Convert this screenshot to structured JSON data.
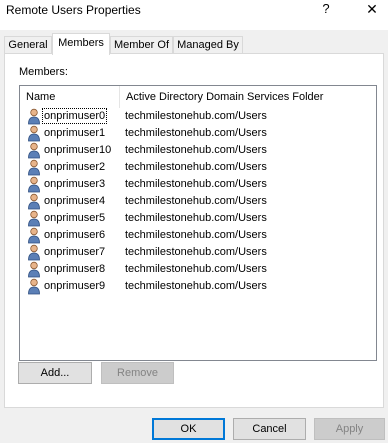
{
  "window": {
    "title": "Remote Users Properties",
    "help_glyph": "?",
    "close_glyph": "✕"
  },
  "tabs": [
    {
      "label": "General"
    },
    {
      "label": "Members"
    },
    {
      "label": "Member Of"
    },
    {
      "label": "Managed By"
    }
  ],
  "active_tab": "Members",
  "members_label": "Members:",
  "columns": {
    "name": "Name",
    "folder": "Active Directory Domain Services Folder"
  },
  "rows": [
    {
      "name": "onprimuser0",
      "folder": "techmilestonehub.com/Users"
    },
    {
      "name": "onprimuser1",
      "folder": "techmilestonehub.com/Users"
    },
    {
      "name": "onprimuser10",
      "folder": "techmilestonehub.com/Users"
    },
    {
      "name": "onprimuser2",
      "folder": "techmilestonehub.com/Users"
    },
    {
      "name": "onprimuser3",
      "folder": "techmilestonehub.com/Users"
    },
    {
      "name": "onprimuser4",
      "folder": "techmilestonehub.com/Users"
    },
    {
      "name": "onprimuser5",
      "folder": "techmilestonehub.com/Users"
    },
    {
      "name": "onprimuser6",
      "folder": "techmilestonehub.com/Users"
    },
    {
      "name": "onprimuser7",
      "folder": "techmilestonehub.com/Users"
    },
    {
      "name": "onprimuser8",
      "folder": "techmilestonehub.com/Users"
    },
    {
      "name": "onprimuser9",
      "folder": "techmilestonehub.com/Users"
    }
  ],
  "selected_row": "onprimuser0",
  "buttons": {
    "add": "Add...",
    "remove": "Remove",
    "ok": "OK",
    "cancel": "Cancel",
    "apply": "Apply"
  },
  "icons": {
    "user": "user-icon"
  },
  "colors": {
    "accent": "#0078d7",
    "dialog_bg": "#f0f0f0",
    "disabled_text": "#838383"
  }
}
